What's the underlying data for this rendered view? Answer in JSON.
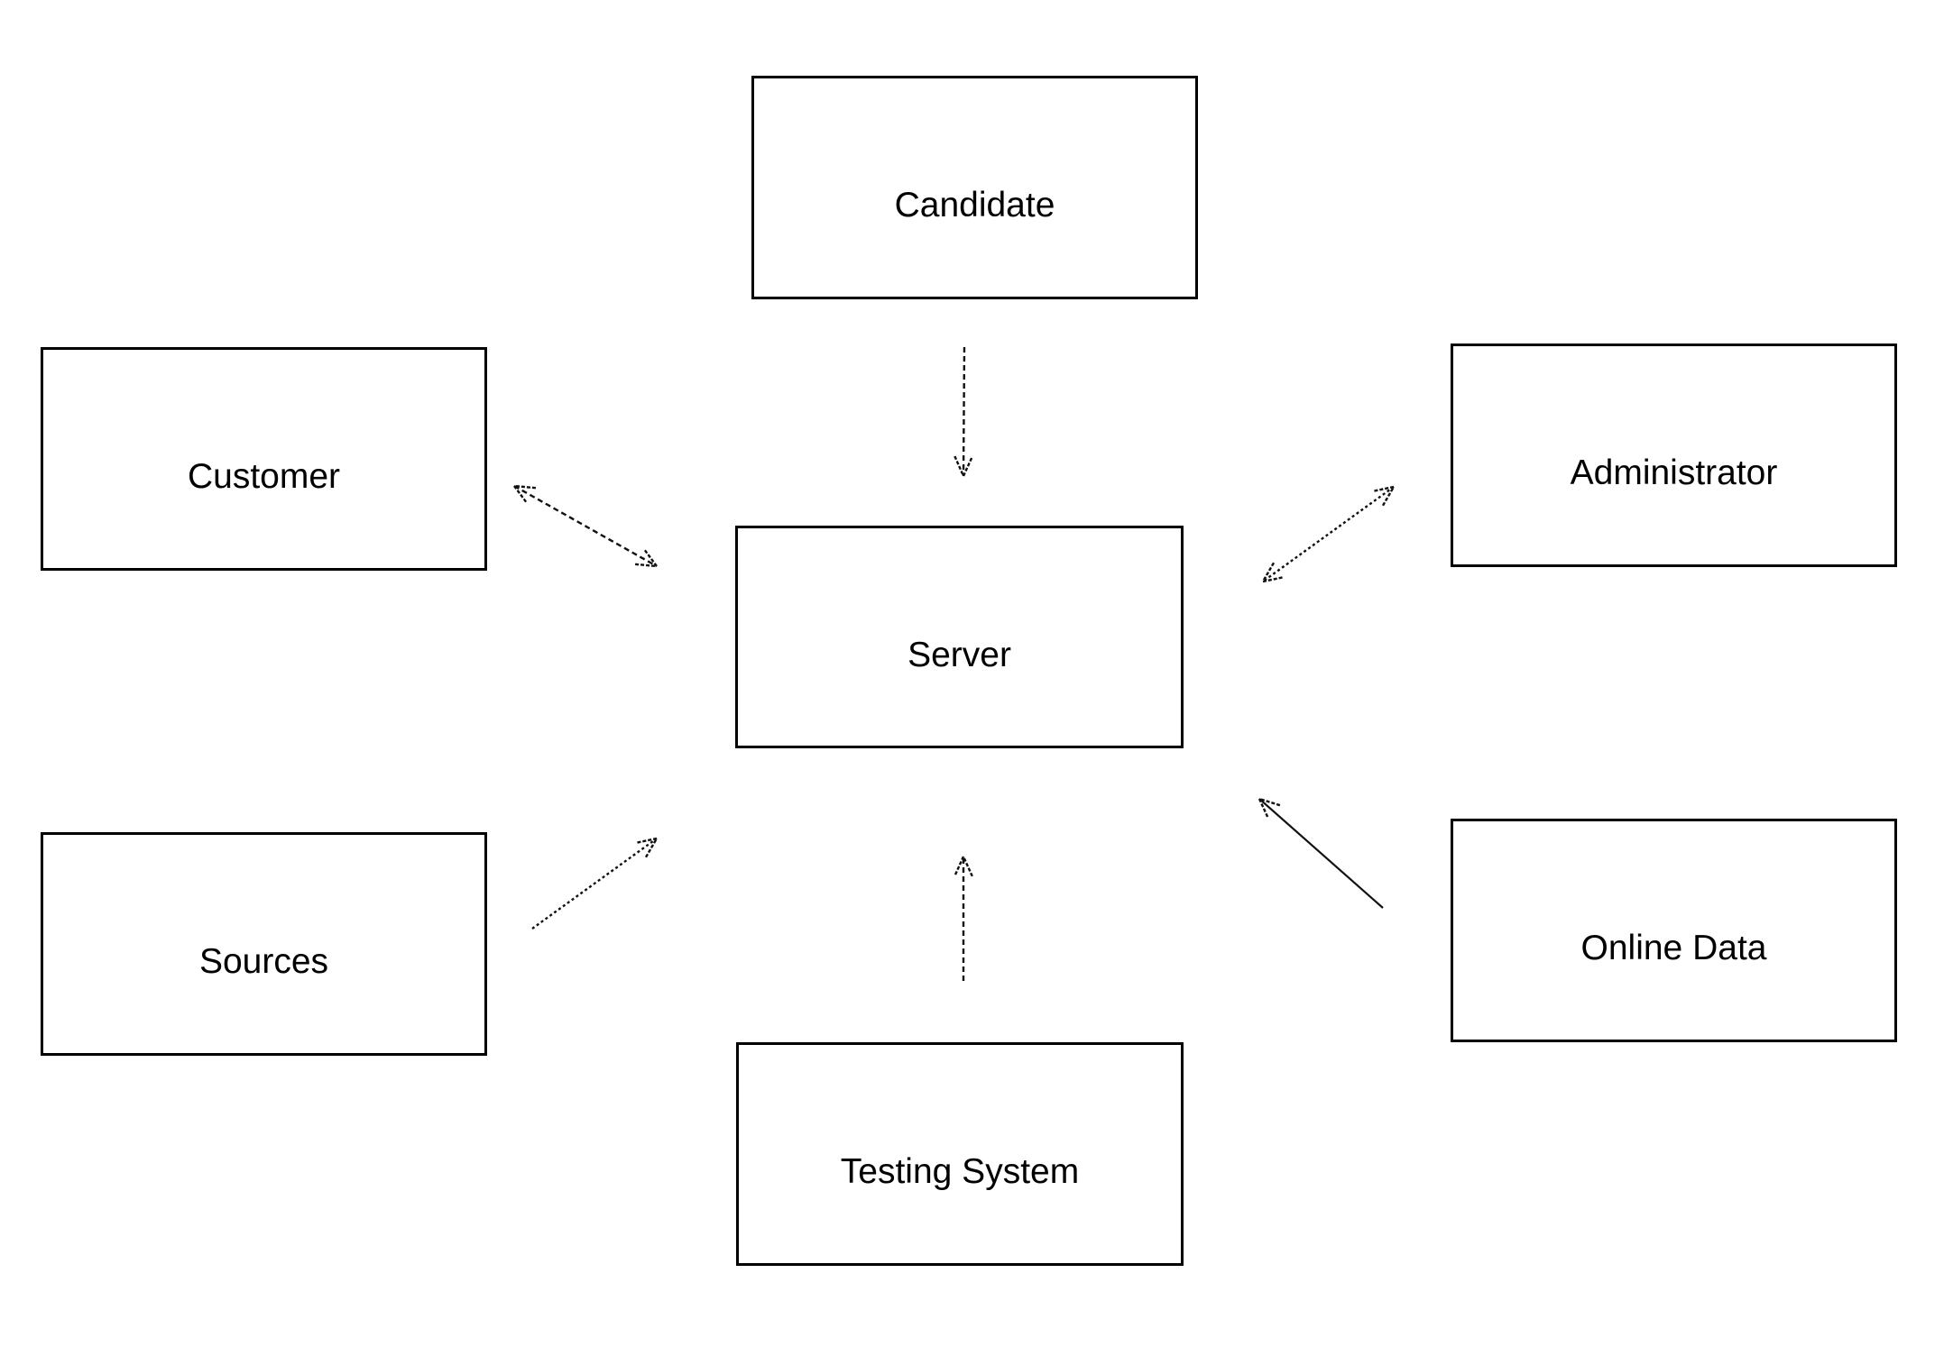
{
  "diagram": {
    "nodes": [
      {
        "id": "candidate",
        "label": "Candidate"
      },
      {
        "id": "customer",
        "label": "Customer"
      },
      {
        "id": "administrator",
        "label": "Administrator"
      },
      {
        "id": "server",
        "label": "Server"
      },
      {
        "id": "sources",
        "label": "Sources"
      },
      {
        "id": "testing_system",
        "label": "Testing System"
      },
      {
        "id": "online_data",
        "label": "Online Data"
      }
    ],
    "edges": [
      {
        "from": "candidate",
        "to": "server",
        "direction": "one-way",
        "style": "dashed"
      },
      {
        "from": "customer",
        "to": "server",
        "direction": "two-way",
        "style": "dashed"
      },
      {
        "from": "administrator",
        "to": "server",
        "direction": "two-way",
        "style": "dotted"
      },
      {
        "from": "sources",
        "to": "server",
        "direction": "one-way",
        "style": "dotted"
      },
      {
        "from": "testing_system",
        "to": "server",
        "direction": "one-way",
        "style": "dashed"
      },
      {
        "from": "online_data",
        "to": "server",
        "direction": "one-way",
        "style": "solid"
      }
    ],
    "colors": {
      "stroke": "#000000",
      "background": "#ffffff",
      "text": "#000000"
    }
  }
}
